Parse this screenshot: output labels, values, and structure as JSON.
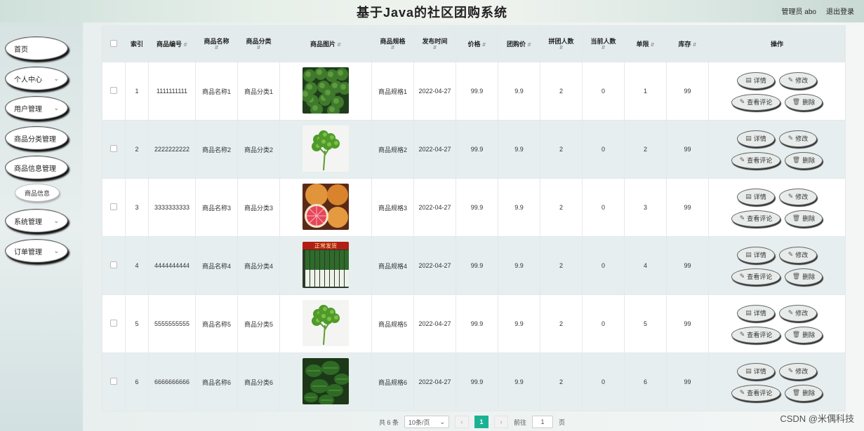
{
  "header": {
    "title": "基于Java的社区团购系统",
    "user": "管理员 abo",
    "logout": "退出登录"
  },
  "sidebar": {
    "items": [
      {
        "label": "首页",
        "chevron": false
      },
      {
        "label": "个人中心",
        "chevron": true
      },
      {
        "label": "用户管理",
        "chevron": true
      },
      {
        "label": "商品分类管理",
        "chevron": false
      },
      {
        "label": "商品信息管理",
        "chevron": false
      },
      {
        "label": "系统管理",
        "chevron": true
      },
      {
        "label": "订单管理",
        "chevron": true
      }
    ],
    "sub_item": "商品信息"
  },
  "table": {
    "headers": {
      "index": "索引",
      "code": "商品编号",
      "name": "商品名称",
      "category": "商品分类",
      "image": "商品图片",
      "spec": "商品规格",
      "time": "发布时间",
      "price": "价格",
      "group_price": "团购价",
      "group_count": "拼团人数",
      "current_count": "当前人数",
      "limit": "单限",
      "stock": "库存",
      "actions": "操作"
    },
    "rows": [
      {
        "index": "1",
        "code": "1111111111",
        "name": "商品名称1",
        "category": "商品分类1",
        "image": "broccoli",
        "spec": "商品规格1",
        "time": "2022-04-27",
        "price": "99.9",
        "group_price": "9.9",
        "group_count": "2",
        "current_count": "0",
        "limit": "1",
        "stock": "99"
      },
      {
        "index": "2",
        "code": "2222222222",
        "name": "商品名称2",
        "category": "商品分类2",
        "image": "parsley",
        "spec": "商品规格2",
        "time": "2022-04-27",
        "price": "99.9",
        "group_price": "9.9",
        "group_count": "2",
        "current_count": "0",
        "limit": "2",
        "stock": "99"
      },
      {
        "index": "3",
        "code": "3333333333",
        "name": "商品名称3",
        "category": "商品分类3",
        "image": "grapefruit",
        "spec": "商品规格3",
        "time": "2022-04-27",
        "price": "99.9",
        "group_price": "9.9",
        "group_count": "2",
        "current_count": "0",
        "limit": "3",
        "stock": "99"
      },
      {
        "index": "4",
        "code": "4444444444",
        "name": "商品名称4",
        "category": "商品分类4",
        "image": "leek",
        "image_banner": "正常发货",
        "spec": "商品规格4",
        "time": "2022-04-27",
        "price": "99.9",
        "group_price": "9.9",
        "group_count": "2",
        "current_count": "0",
        "limit": "4",
        "stock": "99"
      },
      {
        "index": "5",
        "code": "5555555555",
        "name": "商品名称5",
        "category": "商品分类5",
        "image": "parsley",
        "spec": "商品规格5",
        "time": "2022-04-27",
        "price": "99.9",
        "group_price": "9.9",
        "group_count": "2",
        "current_count": "0",
        "limit": "5",
        "stock": "99"
      },
      {
        "index": "6",
        "code": "6666666666",
        "name": "商品名称6",
        "category": "商品分类6",
        "image": "spinach",
        "spec": "商品规格6",
        "time": "2022-04-27",
        "price": "99.9",
        "group_price": "9.9",
        "group_count": "2",
        "current_count": "0",
        "limit": "6",
        "stock": "99"
      }
    ],
    "actions": {
      "detail": "详情",
      "edit": "修改",
      "comments": "查看评论",
      "delete": "删除"
    }
  },
  "pagination": {
    "total": "共 6 条",
    "page_size": "10条/页",
    "current_page": "1",
    "goto_label": "前往",
    "goto_value": "1",
    "page_unit": "页"
  },
  "watermark": "CSDN @米偶科技",
  "colors": {
    "accent": "#19b394"
  }
}
